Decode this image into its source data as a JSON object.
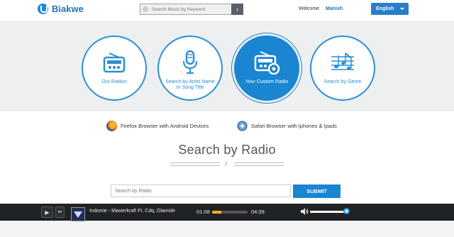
{
  "header": {
    "logo_text": "Biakwe",
    "search_placeholder": "Search Music by Keyword",
    "search_go": "›",
    "welcome_label": "Welcome",
    "user_name": "Manish",
    "language": "English"
  },
  "hero": {
    "items": [
      {
        "label": "Our Radios",
        "icon": "radio-icon",
        "active": false
      },
      {
        "label": "Search by Artist Name or Song Title",
        "icon": "microphone-icon",
        "active": false
      },
      {
        "label": "Your Custom Radio",
        "icon": "radio-settings-icon",
        "active": true
      },
      {
        "label": "Search by Genre",
        "icon": "music-staff-icon",
        "active": false
      }
    ]
  },
  "browsers": {
    "firefox": "Firefox Browser with Android Devices",
    "safari": "Safari Browser with Iphones & Ipads"
  },
  "section": {
    "title": "Search by Radio",
    "note_glyph": "♪"
  },
  "radio_search": {
    "placeholder": "Search by Radio",
    "submit_label": "SUBMIT"
  },
  "player": {
    "track": "Indomie - Masterkraft Ft. Cdq, Olamide",
    "current_time": "01:08",
    "duration": "04:39",
    "progress_fraction": 0.25,
    "volume_fraction": 0.93,
    "play_glyph": "▶",
    "next_glyph": "⏭"
  },
  "colors": {
    "accent": "#1a85d1",
    "brand": "#1c74b8",
    "hero_bg": "#eeeff0",
    "player_bg": "#202325",
    "progress": "#f2b41e"
  }
}
